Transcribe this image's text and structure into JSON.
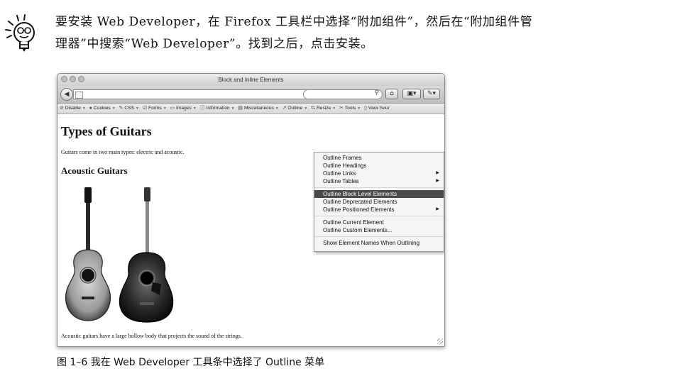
{
  "tip": {
    "line1": "要安装 Web Developer，在 Firefox 工具栏中选择“附加组件”，然后在“附加组件管",
    "line2": "理器”中搜索“Web Developer”。找到之后，点击安装。"
  },
  "window": {
    "title": "Block and Inline Elements"
  },
  "toolbar": {
    "items": [
      {
        "label": "Disable",
        "icon": "disable-icon"
      },
      {
        "label": "Cookies",
        "icon": "cookie-icon"
      },
      {
        "label": "CSS",
        "icon": "pencil-icon"
      },
      {
        "label": "Forms",
        "icon": "form-icon"
      },
      {
        "label": "Images",
        "icon": "image-icon"
      },
      {
        "label": "Information",
        "icon": "info-icon"
      },
      {
        "label": "Miscellaneous",
        "icon": "briefcase-icon"
      },
      {
        "label": "Outline",
        "icon": "outline-icon"
      },
      {
        "label": "Resize",
        "icon": "resize-icon"
      },
      {
        "label": "Tools",
        "icon": "tools-icon"
      },
      {
        "label": "View Sour",
        "icon": "page-icon"
      }
    ]
  },
  "page": {
    "title": "Types of Guitars",
    "intro": "Guitars come in two main types: electric and acoustic.",
    "section_title": "Acoustic Guitars",
    "footer": "Acoustic guitars have a large hollow body that projects the sound of the strings."
  },
  "menu": {
    "items": [
      {
        "label": "Outline Frames",
        "submenu": false,
        "selected": false
      },
      {
        "label": "Outline Headings",
        "submenu": false,
        "selected": false
      },
      {
        "label": "Outline Links",
        "submenu": true,
        "selected": false
      },
      {
        "label": "Outline Tables",
        "submenu": true,
        "selected": false
      },
      {
        "label": "Outline Block Level Elements",
        "submenu": false,
        "selected": true
      },
      {
        "label": "Outline Deprecated Elements",
        "submenu": false,
        "selected": false
      },
      {
        "label": "Outline Positioned Elements",
        "submenu": true,
        "selected": false
      },
      {
        "label": "Outline Current Element",
        "submenu": false,
        "selected": false
      },
      {
        "label": "Outline Custom Elements...",
        "submenu": false,
        "selected": false
      },
      {
        "label": "Show Element Names When Outlining",
        "submenu": false,
        "selected": false
      }
    ]
  },
  "caption": "图 1–6   我在 Web Developer 工具条中选择了 Outline 菜单",
  "colors": {
    "menu_selected": "#4a4a4a",
    "chrome": "#d0d0d0"
  }
}
